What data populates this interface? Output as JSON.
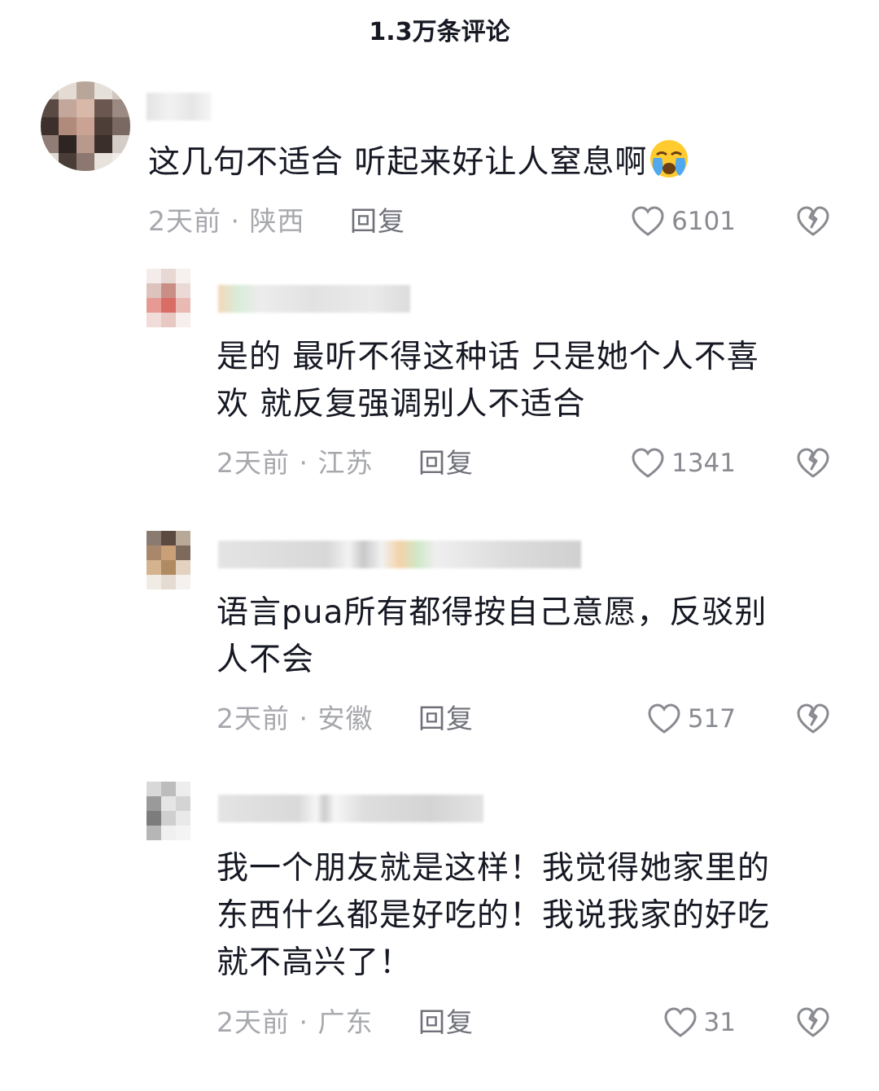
{
  "header": {
    "title": "1.3万条评论"
  },
  "comments": [
    {
      "text": "这几句不适合 听起来好让人窒息啊",
      "emoji": "crying-face-icon",
      "time": "2天前",
      "location": "陕西",
      "reply_label": "回复",
      "likes": "6101"
    },
    {
      "text_lines": [
        "是的 最听不得这种话 只是她个人不喜",
        "欢 就反复强调别人不适合"
      ],
      "time": "2天前",
      "location": "江苏",
      "reply_label": "回复",
      "likes": "1341"
    },
    {
      "text_lines": [
        "语言pua所有都得按自己意愿，反驳别",
        "人不会"
      ],
      "time": "2天前",
      "location": "安徽",
      "reply_label": "回复",
      "likes": "517"
    },
    {
      "text_lines": [
        "我一个朋友就是这样！我觉得她家里的",
        "东西什么都是好吃的！我说我家的好吃",
        "就不高兴了！"
      ],
      "time": "2天前",
      "location": "广东",
      "reply_label": "回复",
      "likes": "31"
    }
  ],
  "meta_separator": " · ",
  "colors": {
    "text": "#161823",
    "meta": "#a7a8ad",
    "reply": "#6f7079",
    "like": "#8a8b91"
  }
}
